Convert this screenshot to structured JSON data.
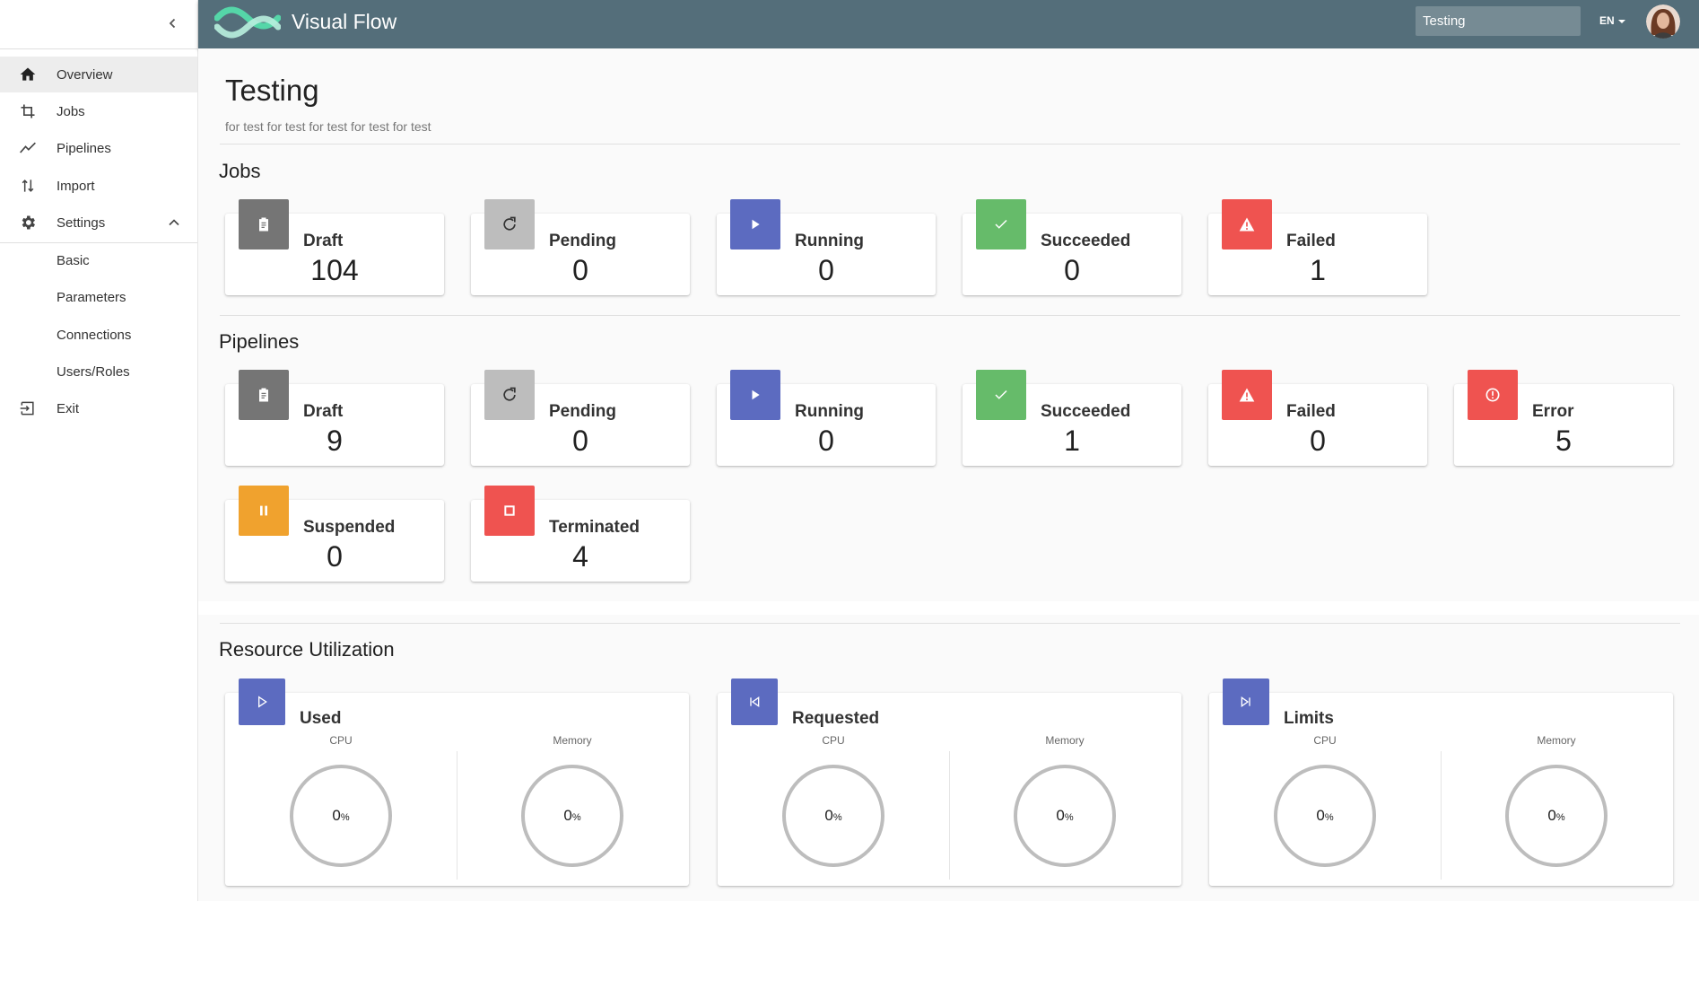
{
  "app": {
    "name": "Visual Flow"
  },
  "topbar": {
    "search_value": "Testing",
    "language": "EN"
  },
  "sidebar": {
    "items": [
      {
        "label": "Overview",
        "icon": "home-icon",
        "active": true
      },
      {
        "label": "Jobs",
        "icon": "crop-icon"
      },
      {
        "label": "Pipelines",
        "icon": "trending-icon"
      },
      {
        "label": "Import",
        "icon": "import-arrows-icon"
      },
      {
        "label": "Settings",
        "icon": "gear-icon",
        "expanded": true
      }
    ],
    "settings_sub": [
      "Basic",
      "Parameters",
      "Connections",
      "Users/Roles"
    ],
    "exit": {
      "label": "Exit",
      "icon": "exit-icon"
    }
  },
  "project": {
    "title": "Testing",
    "description": "for test for test for test for test for test"
  },
  "jobs": {
    "title": "Jobs",
    "cards": [
      {
        "label": "Draft",
        "value": "104",
        "icon": "clipboard-icon",
        "color": "#757575"
      },
      {
        "label": "Pending",
        "value": "0",
        "icon": "refresh-icon",
        "color": "#bdbdbd"
      },
      {
        "label": "Running",
        "value": "0",
        "icon": "play-icon",
        "color": "#5c6bc0"
      },
      {
        "label": "Succeeded",
        "value": "0",
        "icon": "check-icon",
        "color": "#66bb6a"
      },
      {
        "label": "Failed",
        "value": "1",
        "icon": "warning-icon",
        "color": "#ef5350"
      }
    ]
  },
  "pipelines": {
    "title": "Pipelines",
    "cards": [
      {
        "label": "Draft",
        "value": "9",
        "icon": "clipboard-icon",
        "color": "#757575"
      },
      {
        "label": "Pending",
        "value": "0",
        "icon": "refresh-icon",
        "color": "#bdbdbd"
      },
      {
        "label": "Running",
        "value": "0",
        "icon": "play-icon",
        "color": "#5c6bc0"
      },
      {
        "label": "Succeeded",
        "value": "1",
        "icon": "check-icon",
        "color": "#66bb6a"
      },
      {
        "label": "Failed",
        "value": "0",
        "icon": "warning-icon",
        "color": "#ef5350"
      },
      {
        "label": "Error",
        "value": "5",
        "icon": "error-icon",
        "color": "#ef5350"
      },
      {
        "label": "Suspended",
        "value": "0",
        "icon": "pause-icon",
        "color": "#f0a22e"
      },
      {
        "label": "Terminated",
        "value": "4",
        "icon": "stop-icon",
        "color": "#ef5350"
      }
    ]
  },
  "resources": {
    "title": "Resource Utilization",
    "cpu_label": "CPU",
    "memory_label": "Memory",
    "percent_sign": "%",
    "cards": [
      {
        "label": "Used",
        "icon": "play-outline-icon",
        "cpu": "0",
        "memory": "0"
      },
      {
        "label": "Requested",
        "icon": "skip-previous-icon",
        "cpu": "0",
        "memory": "0"
      },
      {
        "label": "Limits",
        "icon": "skip-next-icon",
        "cpu": "0",
        "memory": "0"
      }
    ]
  },
  "colors": {
    "topbar": "#546e7a",
    "accent": "#5c6bc0"
  }
}
